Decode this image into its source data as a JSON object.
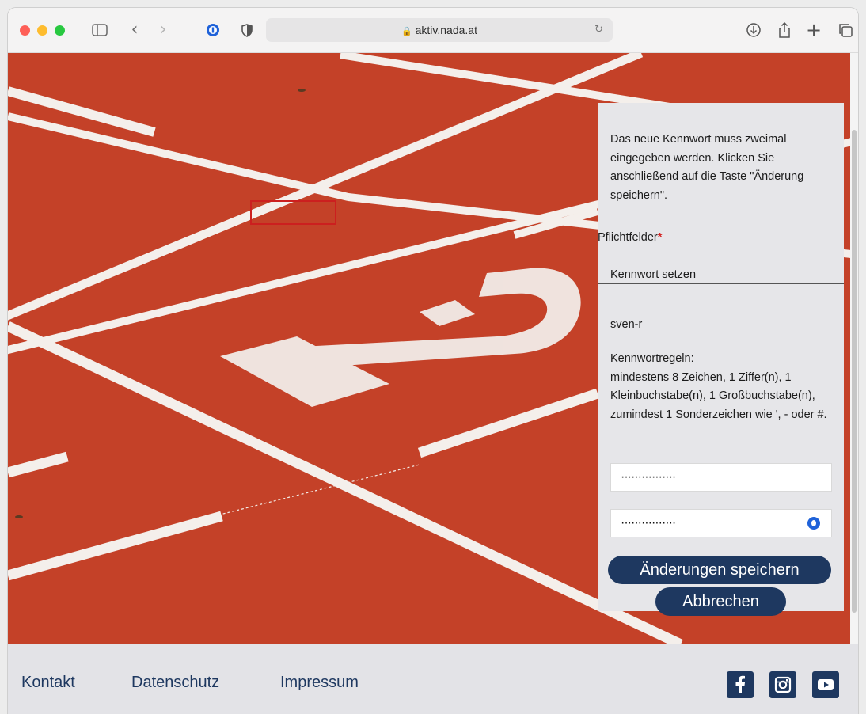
{
  "browser": {
    "url": "aktiv.nada.at",
    "traffic_lights": [
      "#fe5f57",
      "#febc2e",
      "#28c840"
    ],
    "icons": [
      "sidebar-icon",
      "back-icon",
      "forward-icon",
      "password-manager-icon",
      "privacy-shield-icon",
      "lock-icon",
      "reload-icon",
      "download-icon",
      "share-icon",
      "new-tab-icon",
      "tabs-overview-icon"
    ]
  },
  "panel": {
    "intro": "Das neue Kennwort muss zweimal eingegeben werden. Klicken Sie anschließend auf die Taste \"Änderung speichern\".",
    "required_label": "Pflichtfelder",
    "required_star": "*",
    "section_title": "Kennwort setzen",
    "username": "sven-r",
    "rules_heading": "Kennwortregeln:",
    "rules_text": "mindestens 8 Zeichen, 1 Ziffer(n), 1 Kleinbuchstabe(n), 1 Großbuchstabe(n), zumindest 1 Sonderzeichen wie ', - oder #.",
    "password_value": "················",
    "password_confirm_value": "················",
    "save_label": "Änderungen speichern",
    "cancel_label": "Abbrechen"
  },
  "footer": {
    "links": [
      "Kontakt",
      "Datenschutz",
      "Impressum"
    ],
    "social": [
      "facebook-icon",
      "instagram-icon",
      "youtube-icon"
    ]
  },
  "colors": {
    "track": "#c8432a",
    "accent": "#1e3860",
    "required": "#d42525"
  }
}
